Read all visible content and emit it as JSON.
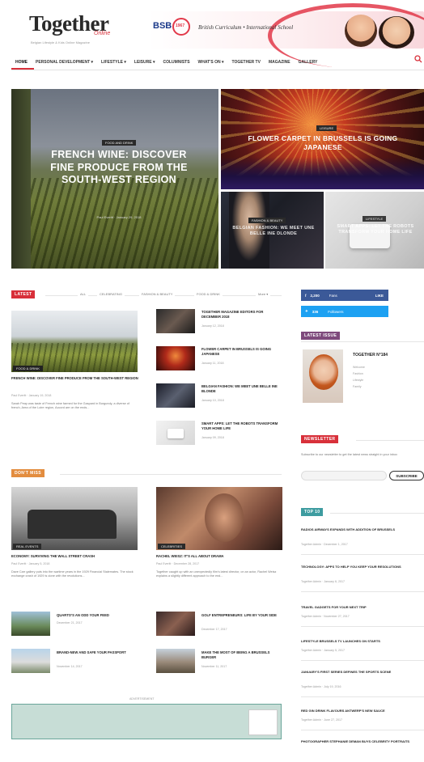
{
  "header": {
    "logo": "Together",
    "logo_sub": "Online",
    "tagline": "Belgian Lifestyle & Kids Online Magazine",
    "banner": {
      "brand": "BSB",
      "badge": "1967",
      "text": "British Curriculum • International School"
    }
  },
  "nav": {
    "items": [
      {
        "label": "HOME"
      },
      {
        "label": "PERSONAL DEVELOPMENT ▾"
      },
      {
        "label": "LIFESTYLE ▾"
      },
      {
        "label": "LEISURE ▾"
      },
      {
        "label": "COLUMNISTS"
      },
      {
        "label": "WHAT'S ON ▾"
      },
      {
        "label": "TOGETHER TV"
      },
      {
        "label": "MAGAZINE"
      },
      {
        "label": "GALLERY"
      }
    ],
    "search_icon": "search-icon"
  },
  "hero": {
    "main": {
      "tag": "FOOD AND DRINK",
      "title": "FRENCH WINE: DISCOVER FINE PRODUCE FROM THE SOUTH-WEST REGION",
      "meta": "Paul Everitt · January 29, 2018"
    },
    "top_right": {
      "tag": "LEISURE",
      "title": "FLOWER CARPET IN BRUSSELS IS GOING JAPANESE"
    },
    "bottom_left": {
      "tag": "FASHION & BEAUTY",
      "title": "BELGIAN FASHION: WE MEET UNE BELLE INE DLONDE"
    },
    "bottom_right": {
      "tag": "LIFESTYLE",
      "title": "SMART APPS: LET THE ROBOTS TRANSFORM YOUR HOME LIFE"
    }
  },
  "latest": {
    "label": "LATEST",
    "filters": [
      "ALL",
      "CELEBRATING",
      "FASHION & BEAUTY",
      "FOOD & DRINK",
      "More ▾"
    ],
    "feature": {
      "badge": "Food & drink",
      "title": "FRENCH WINE: DISCOVER FINE PRODUCE FROM THE SOUTH-WEST REGION",
      "meta": "Paul Everitt · January 19, 2018",
      "excerpt": "Sarah Peay was taste of French wine farmed for the Gaspard in Burgundy, a diverse of french, Area of the Loire region, Accord are on the ends..."
    },
    "list": [
      {
        "title": "TOGETHER MAGAZINE EDITORS FOR DECEMBER 2018",
        "meta": "January 12, 2018"
      },
      {
        "title": "FLOWER CARPET IN BRUSSELS IS GOING JAPANESE",
        "meta": "January 11, 2018"
      },
      {
        "title": "BELGIAN FASHION: WE MEET UNE BELLE INE BLONDE",
        "meta": "January 10, 2018"
      },
      {
        "title": "SMART APPS: LET THE ROBOTS TRANSFORM YOUR HOME LIFE",
        "meta": "January 09, 2018"
      }
    ]
  },
  "dont_miss": {
    "label": "DON'T MISS",
    "cards": [
      {
        "badge": "Real Events",
        "title": "ECONOMY: SURVIVING THE WALL STREET CRASH",
        "meta": "Paul Everitt · January 5, 2018",
        "excerpt": "Dave Carr gallery puts into the wartime years in the 1929 Financial Stalemates. The stock exchange crash of 1929 is done with the revolutions..."
      },
      {
        "badge": "Celebrities",
        "title": "RACHEL WEISZ: IT'S ALL ABOUT DRAMA",
        "meta": "Paul Everitt · December 28, 2017",
        "excerpt": "Together caught up with an unexpectedly film's latest director, on an actor, Rachel Weisz explains a slightly different approach to the end..."
      }
    ],
    "small": [
      {
        "title": "QUARTO'S AN ODD YOUR FEED",
        "meta": "December 21, 2017"
      },
      {
        "title": "GOLF ENTREPRENEURS: LIFE BY YOUR SIDE",
        "meta": "December 17, 2017"
      },
      {
        "title": "BRAND-NEW AND SAFE YOUR PASSPORT",
        "meta": "November 14, 2017"
      },
      {
        "title": "MAKE THE MOST OF BEING A BRUSSELS BURGER",
        "meta": "November 11, 2017"
      }
    ]
  },
  "advert_label": "ADVERTISEMENT",
  "sidebar": {
    "facebook": {
      "label": "2,200",
      "action": "Fans",
      "count": "LIKE"
    },
    "twitter": {
      "label": "336",
      "action": "Followers"
    },
    "latest_issue": {
      "label": "LATEST ISSUE",
      "title": "TOGETHER N°184",
      "lines": [
        "Welcome",
        "Fashion",
        "Lifestyle",
        "Family"
      ]
    },
    "newsletter": {
      "label": "NEWSLETTER",
      "text": "Subscribe to our newsletter to get the latest news straight in your inbox",
      "placeholder": "",
      "button": "SUBSCRIBE"
    },
    "top": {
      "label": "TOP 10",
      "items": [
        {
          "title": "RADIOS AIRWAYS EXPANDS WITH ADDITION OF BRUSSELS",
          "meta": "Together Admin · December 1, 2017"
        },
        {
          "title": "TECHNOLOGY: APPS TO HELP YOU KEEP YOUR RESOLUTIONS",
          "meta": "Together Admin · January 6, 2017"
        },
        {
          "title": "TRAVEL GADGETS FOR YOUR NEXT TRIP",
          "meta": "Together Admin · November 27, 2017"
        },
        {
          "title": "LIFESTYLE BRUSSELS TV LAUNCHES ON STARTS",
          "meta": "Together Admin · January 5, 2017"
        },
        {
          "title": "JANUARY'S FIRST SERIES DEFINES THE SPORTS SCENE",
          "meta": "Together Admin · July 19, 2016"
        },
        {
          "title": "RED GIN DRINK FLAVOURS ANTWERP'S NEW SAUCE",
          "meta": "Together Admin · June 27, 2017"
        },
        {
          "title": "PHOTOGRAPHER STEPHANIE DEMAN BUYS CELEBRITY PORTRAITS",
          "meta": ""
        }
      ]
    }
  }
}
